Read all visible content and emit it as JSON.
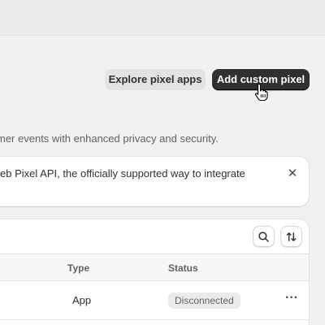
{
  "actions": {
    "explore_label": "Explore pixel apps",
    "add_label": "Add custom pixel"
  },
  "description": "mer events with enhanced privacy and security.",
  "banner": {
    "text": "eb Pixel API, the officially supported way to integrate",
    "close_glyph": "✕"
  },
  "table": {
    "headers": {
      "type": "Type",
      "status": "Status"
    },
    "rows": [
      {
        "type": "App",
        "status": "Disconnected",
        "more_glyph": "···"
      }
    ]
  },
  "icons": {
    "search": "search-icon",
    "sort": "sort-icon",
    "cursor": "hand-pointer-cursor"
  },
  "colors": {
    "primary_button": "#303030",
    "secondary_button": "#e3e3e3",
    "badge_bg": "#ebebeb"
  }
}
